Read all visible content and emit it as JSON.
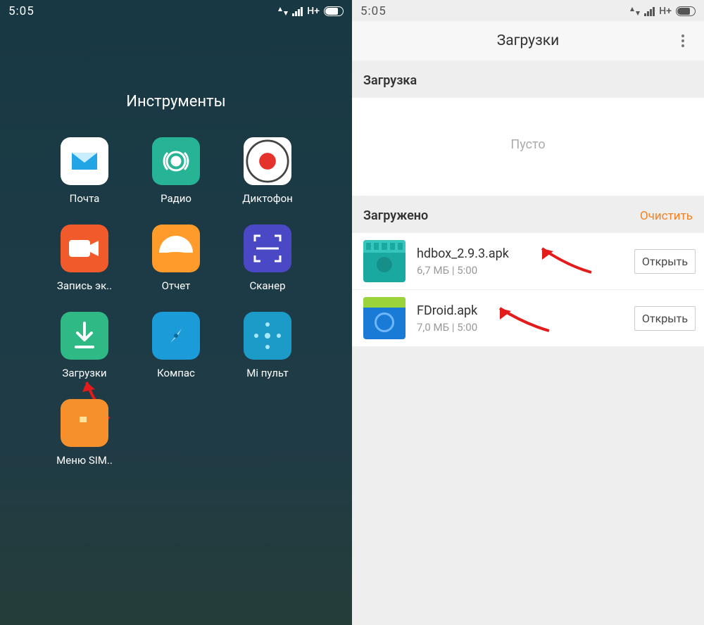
{
  "status": {
    "time": "5:05",
    "network_label": "H+"
  },
  "left": {
    "folder_title": "Инструменты",
    "apps": [
      {
        "id": "mail",
        "label": "Почта"
      },
      {
        "id": "radio",
        "label": "Радио"
      },
      {
        "id": "recorder",
        "label": "Диктофон"
      },
      {
        "id": "screenrec",
        "label": "Запись эк.."
      },
      {
        "id": "report",
        "label": "Отчет"
      },
      {
        "id": "scanner",
        "label": "Сканер"
      },
      {
        "id": "downloads",
        "label": "Загрузки"
      },
      {
        "id": "compass",
        "label": "Компас"
      },
      {
        "id": "remote",
        "label": "Mi пульт"
      },
      {
        "id": "sim",
        "label": "Меню SIM.."
      }
    ]
  },
  "right": {
    "header_title": "Загрузки",
    "section_downloading_title": "Загрузка",
    "empty_text": "Пусто",
    "section_downloaded_title": "Загружено",
    "clear_action": "Очистить",
    "open_button": "Открыть",
    "items": [
      {
        "name": "hdbox_2.9.3.apk",
        "size": "6,7 МБ",
        "time": "5:00"
      },
      {
        "name": "FDroid.apk",
        "size": "7,0 МБ",
        "time": "5:00"
      }
    ]
  }
}
